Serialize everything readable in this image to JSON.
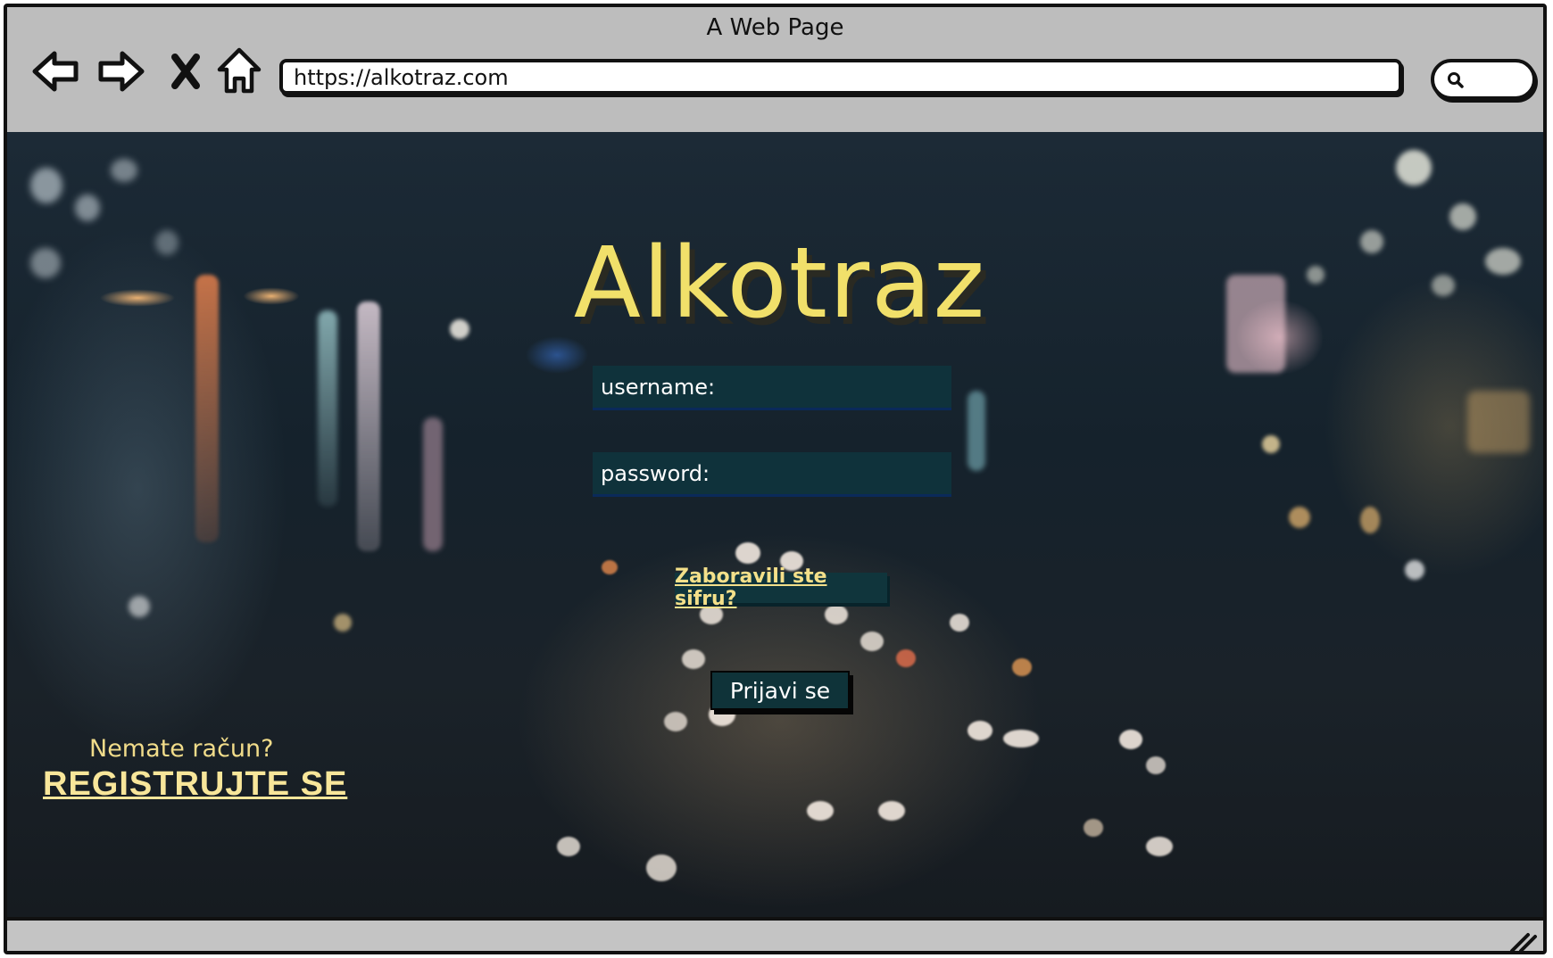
{
  "window": {
    "title": "A Web Page",
    "url": "https://alkotraz.com"
  },
  "toolbar": {
    "back_icon": "arrow-left-icon",
    "forward_icon": "arrow-right-icon",
    "stop_icon": "close-icon",
    "home_icon": "home-icon",
    "search_icon": "search-icon"
  },
  "login": {
    "brand": "Alkotraz",
    "username_placeholder": "username:",
    "password_placeholder": "password:",
    "forgot_link": "Zaboravili ste sifru?",
    "submit_label": "Prijavi se"
  },
  "signup": {
    "prompt": "Nemate račun?",
    "link": "REGISTRUJTE SE"
  },
  "colors": {
    "accent_yellow": "#f1e06a",
    "field_bg": "#0f323b",
    "chrome_gray": "#c4c4c4"
  }
}
